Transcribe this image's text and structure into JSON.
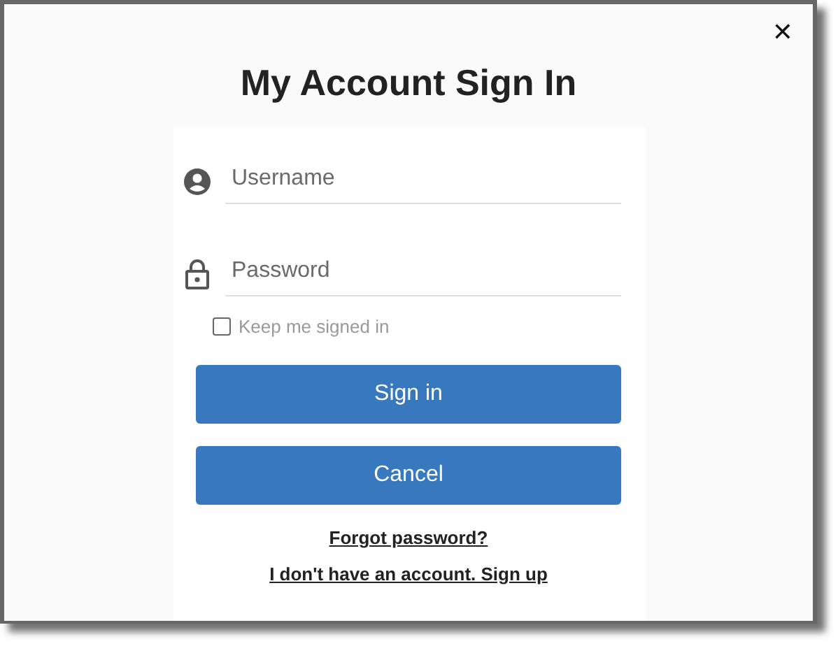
{
  "dialog": {
    "title": "My Account Sign In",
    "close": "✕"
  },
  "fields": [
    {
      "kind": "username",
      "placeholder": "Username"
    },
    {
      "kind": "password",
      "placeholder": "Password"
    }
  ],
  "remember": {
    "label": "Keep me signed in",
    "checked": false
  },
  "buttons": [
    "Sign in",
    "Cancel"
  ],
  "links": [
    "Forgot password?",
    "I don't have an account. Sign up"
  ]
}
